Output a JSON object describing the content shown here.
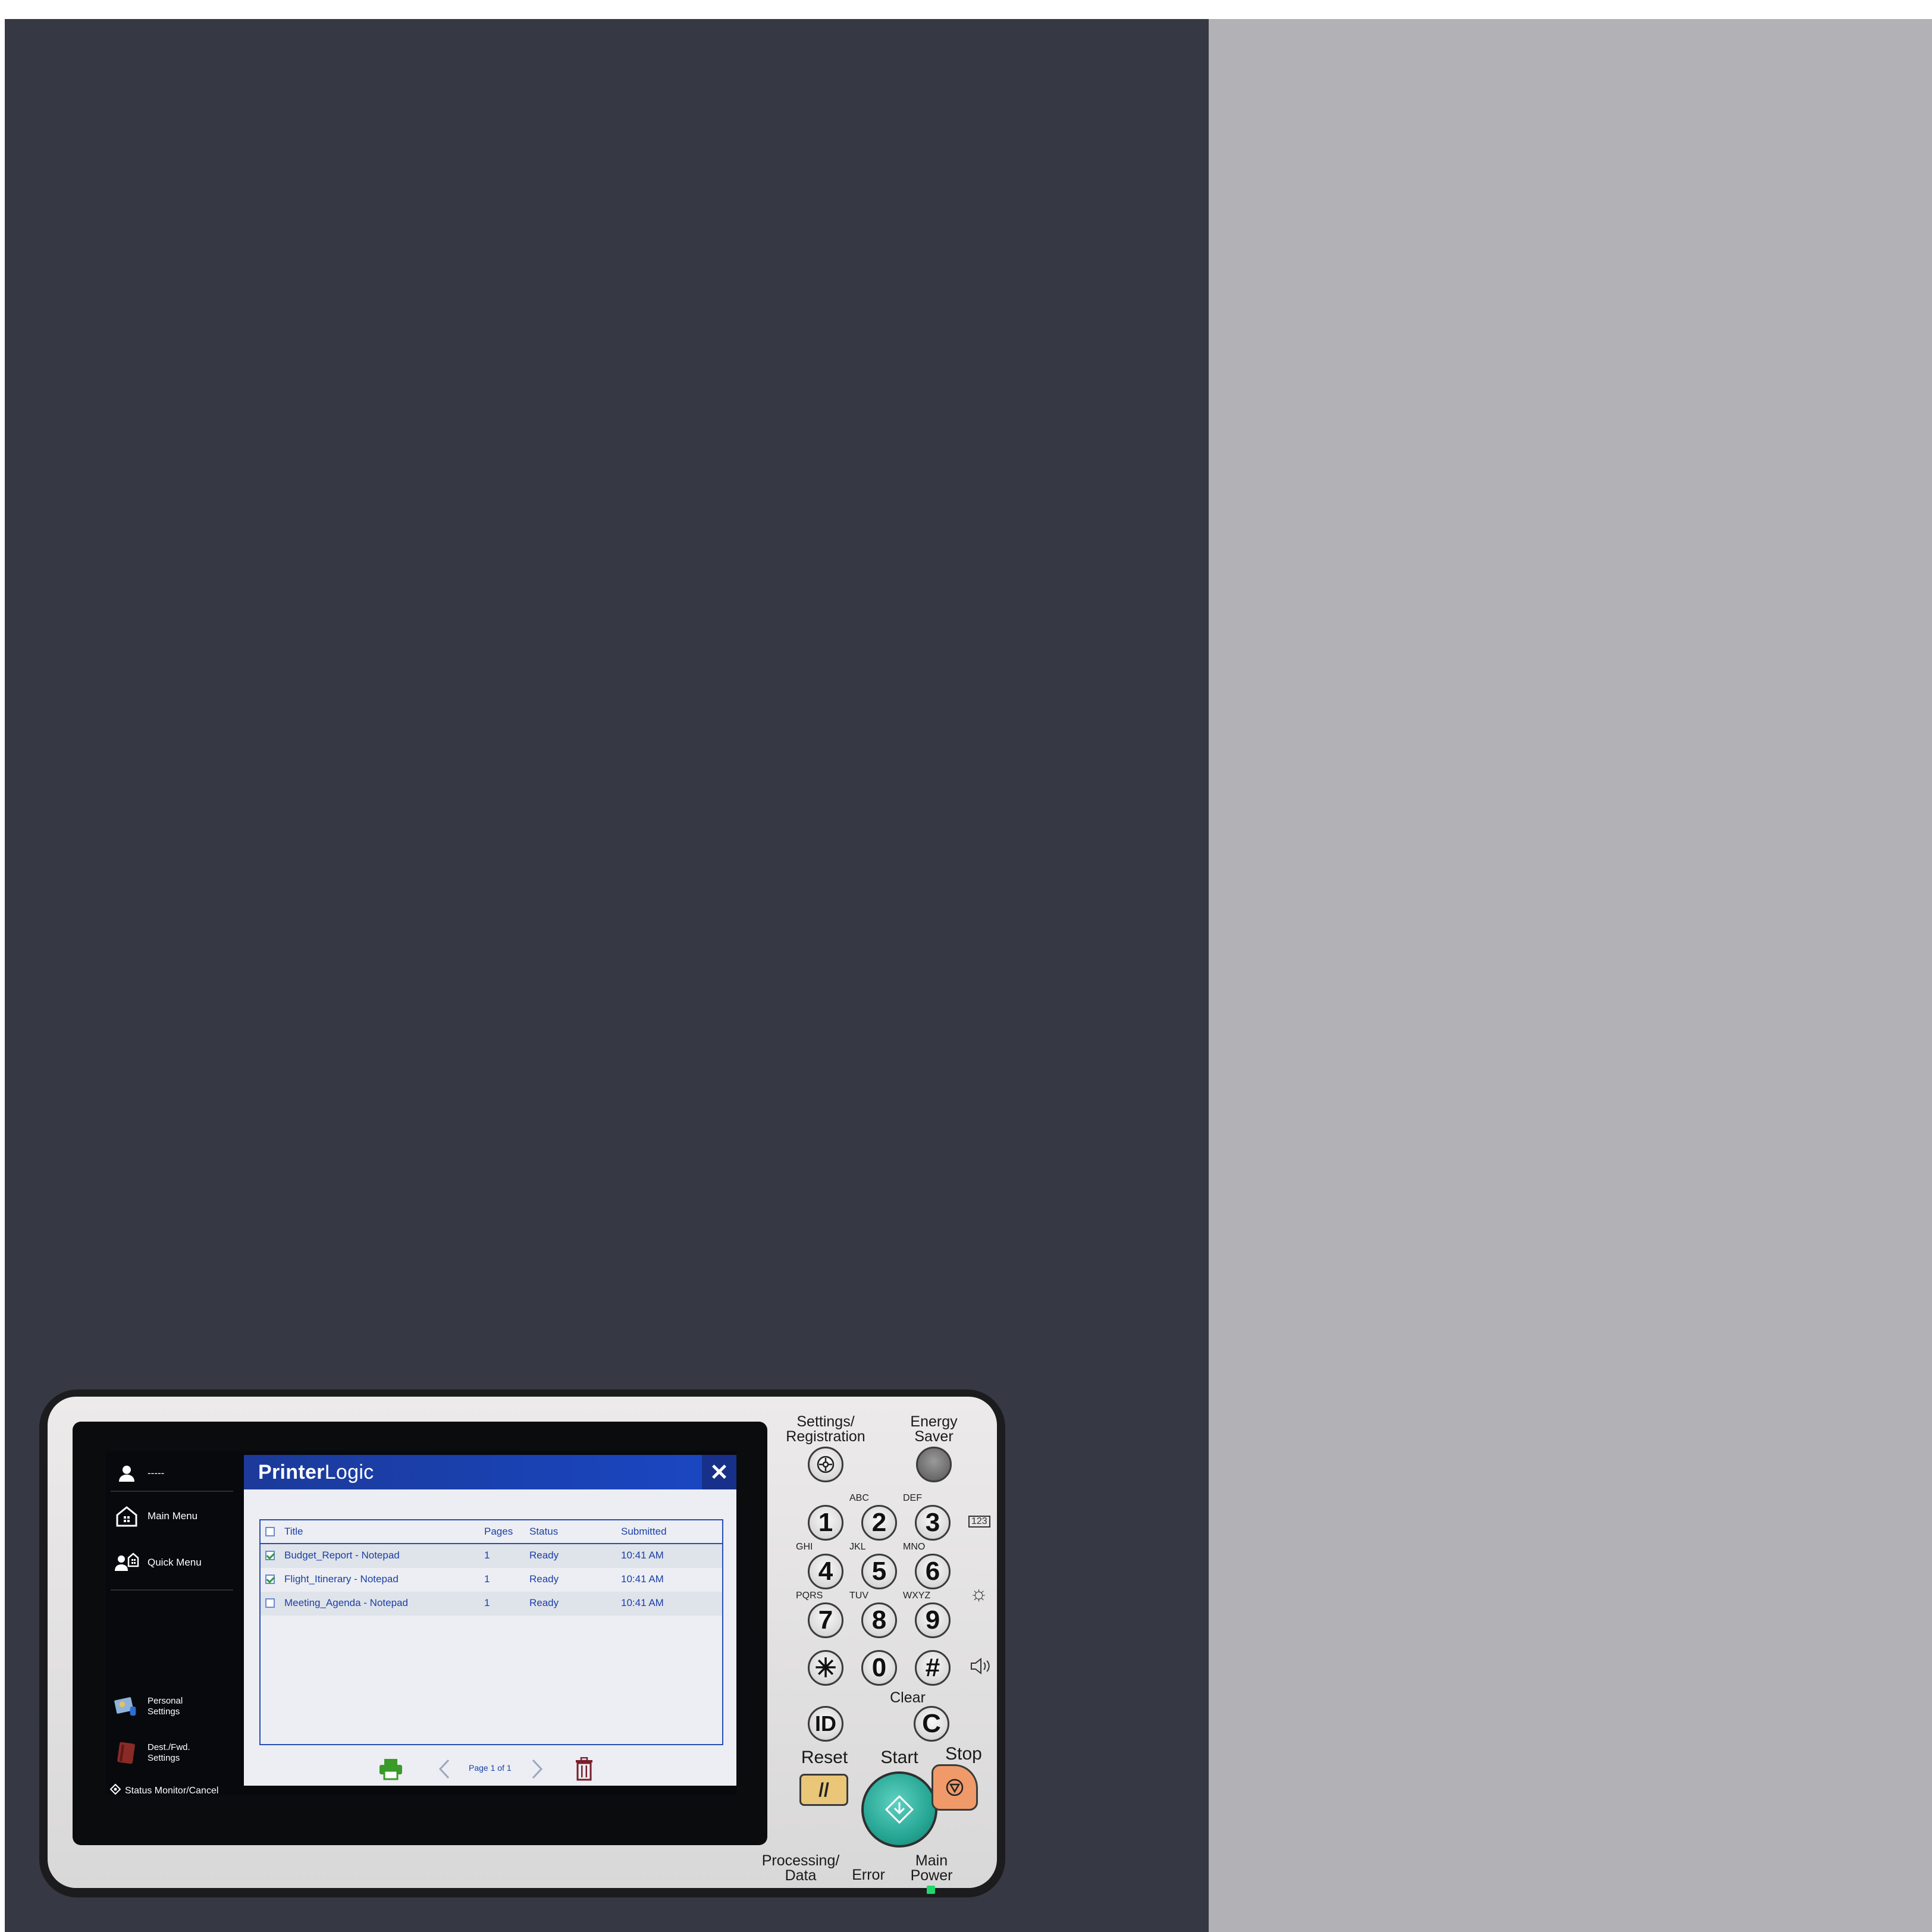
{
  "screen": {
    "user": {
      "name": "-----"
    },
    "side_menu": {
      "main_menu": "Main Menu",
      "quick_menu": "Quick Menu",
      "personal_settings": [
        "Personal",
        "Settings"
      ],
      "dest_settings": [
        "Dest./Fwd.",
        "Settings"
      ],
      "status_monitor": "Status Monitor/Cancel"
    },
    "dialog": {
      "brand_bold": "Printer",
      "brand_light": "Logic",
      "close_icon": "✕",
      "columns": {
        "title": "Title",
        "pages": "Pages",
        "status": "Status",
        "submitted": "Submitted"
      },
      "jobs": [
        {
          "title": "Budget_Report - Notepad",
          "pages": "1",
          "status": "Ready",
          "submitted": "10:41 AM",
          "checked": true
        },
        {
          "title": "Flight_Itinerary - Notepad",
          "pages": "1",
          "status": "Ready",
          "submitted": "10:41 AM",
          "checked": true
        },
        {
          "title": "Meeting_Agenda - Notepad",
          "pages": "1",
          "status": "Ready",
          "submitted": "10:41 AM",
          "checked": false
        }
      ],
      "page_indicator": "Page 1 of 1",
      "colors": {
        "header": "#1a47c4",
        "text": "#1b3fa6",
        "print": "#3a9a2a",
        "delete": "#7a1f2a"
      }
    }
  },
  "hardware": {
    "settings_registration": [
      "Settings/",
      "Registration"
    ],
    "energy_saver": [
      "Energy",
      "Saver"
    ],
    "keys": [
      {
        "digit": "1",
        "letters": ""
      },
      {
        "digit": "2",
        "letters": "ABC"
      },
      {
        "digit": "3",
        "letters": "DEF"
      },
      {
        "digit": "4",
        "letters": "GHI"
      },
      {
        "digit": "5",
        "letters": "JKL"
      },
      {
        "digit": "6",
        "letters": "MNO"
      },
      {
        "digit": "7",
        "letters": "PQRS"
      },
      {
        "digit": "8",
        "letters": "TUV"
      },
      {
        "digit": "9",
        "letters": "WXYZ"
      },
      {
        "digit": "✳",
        "letters": ""
      },
      {
        "digit": "0",
        "letters": ""
      },
      {
        "digit": "#",
        "letters": ""
      }
    ],
    "id_key": "ID",
    "clear_key": "C",
    "clear_label": "Clear",
    "reset_label": "Reset",
    "start_label": "Start",
    "stop_label": "Stop",
    "processing_label": [
      "Processing/",
      "Data"
    ],
    "error_label": "Error",
    "main_power_label": [
      "Main",
      "Power"
    ],
    "counter_icon": "123"
  }
}
